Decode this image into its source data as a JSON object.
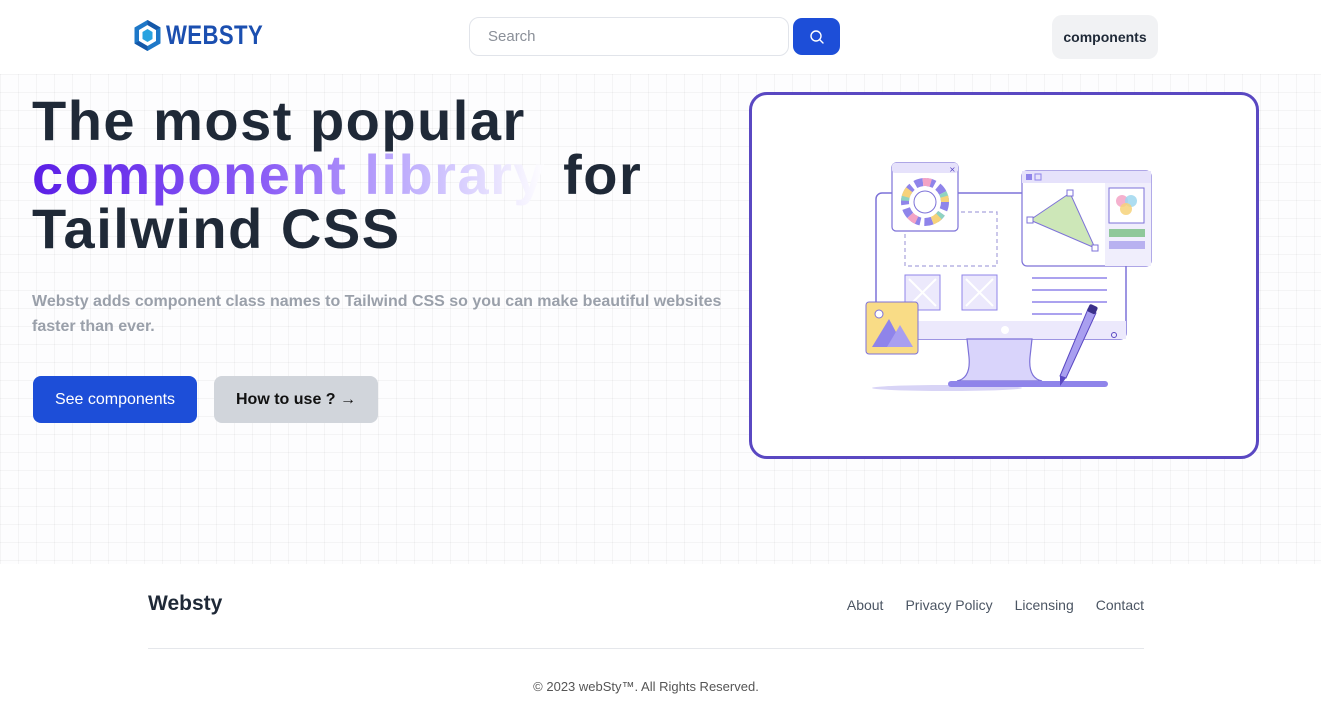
{
  "header": {
    "logo_text": "WEBSTY",
    "search_placeholder": "Search",
    "components_label": "components"
  },
  "hero": {
    "title_line1": "The most popular",
    "title_highlight": "component library",
    "title_line2_suffix": " for",
    "title_line3": "Tailwind CSS",
    "description": "Websty adds component class names to Tailwind CSS so you can make beautiful websites faster than ever.",
    "primary_button": "See components",
    "secondary_button": "How to use ? →"
  },
  "footer": {
    "brand": "Websty",
    "links": [
      "About",
      "Privacy Policy",
      "Licensing",
      "Contact"
    ],
    "copyright": "© 2023 webSty™. All Rights Reserved."
  },
  "colors": {
    "primary": "#1d4ed8",
    "frame_border": "#5a48c2",
    "gradient_start": "#5b1ee6",
    "logo": "#1b4fb0"
  },
  "icons": [
    "websty-logo-icon",
    "search-icon"
  ]
}
